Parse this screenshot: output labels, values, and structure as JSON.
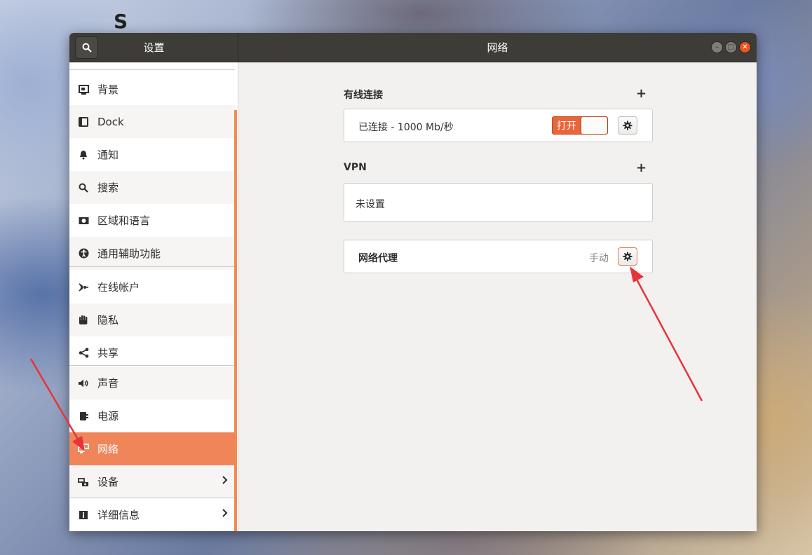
{
  "desktop": {
    "letter": "S"
  },
  "window": {
    "sidebar_title": "设置",
    "content_title": "网络",
    "controls": [
      "minimize",
      "maximize",
      "close"
    ]
  },
  "sidebar": {
    "items": [
      {
        "label": "背景",
        "icon": "background-icon"
      },
      {
        "label": "Dock",
        "icon": "dock-icon"
      },
      {
        "label": "通知",
        "icon": "bell-icon"
      },
      {
        "label": "搜索",
        "icon": "search-icon"
      },
      {
        "label": "区域和语言",
        "icon": "region-icon"
      },
      {
        "label": "通用辅助功能",
        "icon": "accessibility-icon"
      },
      {
        "label": "在线帐户",
        "icon": "online-accounts-icon"
      },
      {
        "label": "隐私",
        "icon": "privacy-hand-icon"
      },
      {
        "label": "共享",
        "icon": "share-icon"
      },
      {
        "label": "声音",
        "icon": "speaker-icon"
      },
      {
        "label": "电源",
        "icon": "power-icon"
      },
      {
        "label": "网络",
        "icon": "network-icon",
        "active": true
      },
      {
        "label": "设备",
        "icon": "devices-icon",
        "has_submenu": true
      },
      {
        "label": "详细信息",
        "icon": "info-icon",
        "has_submenu": true
      }
    ]
  },
  "network": {
    "wired": {
      "title": "有线连接",
      "add_label": "+",
      "status": "已连接 - 1000 Mb/秒",
      "toggle_label": "打开",
      "toggle_on": true
    },
    "vpn": {
      "title": "VPN",
      "add_label": "+",
      "status": "未设置"
    },
    "proxy": {
      "title": "网络代理",
      "mode": "手动"
    }
  },
  "colors": {
    "accent": "#f0855a",
    "titlebar": "#3d3c37",
    "close": "#e95420",
    "annotation_arrow": "#e8333a"
  }
}
